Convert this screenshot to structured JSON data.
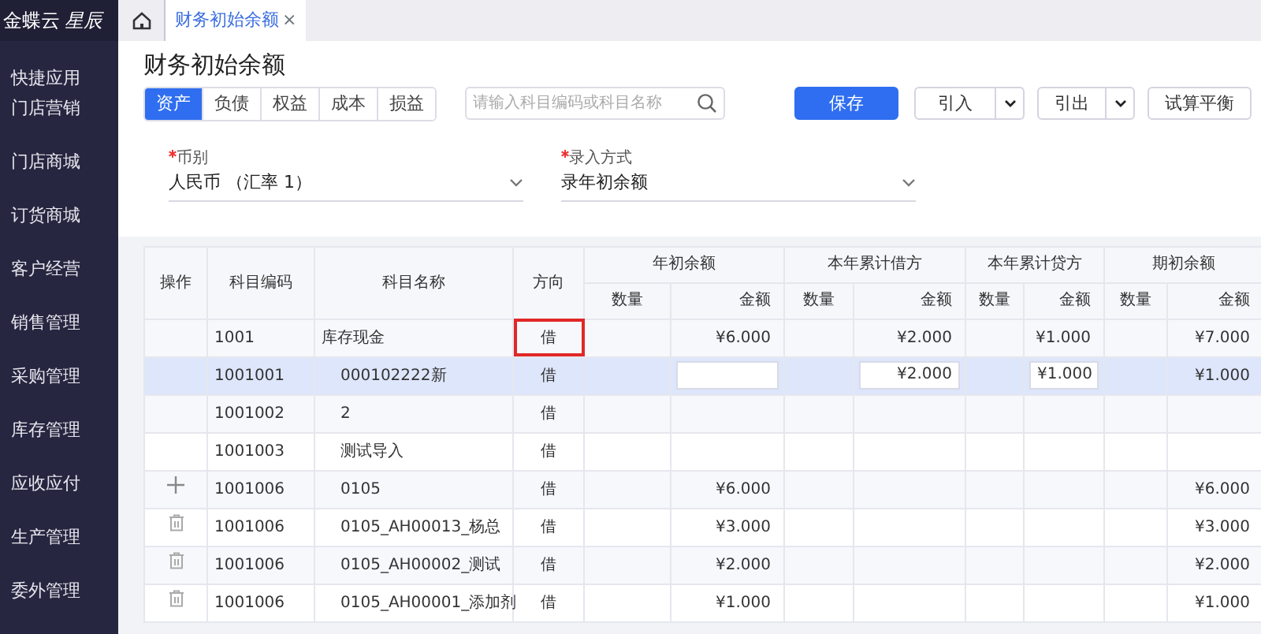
{
  "logo": {
    "brand": "金蝶云",
    "product": "星辰"
  },
  "sidebar": {
    "items": [
      {
        "label": "快捷应用"
      },
      {
        "label": "门店营销"
      },
      {
        "label": "门店商城"
      },
      {
        "label": "订货商城"
      },
      {
        "label": "客户经营"
      },
      {
        "label": "销售管理"
      },
      {
        "label": "采购管理"
      },
      {
        "label": "库存管理"
      },
      {
        "label": "应收应付"
      },
      {
        "label": "生产管理"
      },
      {
        "label": "委外管理"
      }
    ]
  },
  "page_tabs": [
    {
      "label": "财务初始余额",
      "close": "×",
      "selected": true
    }
  ],
  "title": "财务初始余额",
  "category_tabs": [
    {
      "label": "资产",
      "selected": true
    },
    {
      "label": "负债",
      "selected": false
    },
    {
      "label": "权益",
      "selected": false
    },
    {
      "label": "成本",
      "selected": false
    },
    {
      "label": "损益",
      "selected": false
    }
  ],
  "search": {
    "placeholder": "请输入科目编码或科目名称"
  },
  "actions": [
    {
      "label": "保存",
      "kind": "primary"
    },
    {
      "label": "引入",
      "kind": "split"
    },
    {
      "label": "引出",
      "kind": "split"
    },
    {
      "label": "试算平衡",
      "kind": "plain"
    }
  ],
  "fields": [
    {
      "label": "币别",
      "required": true,
      "value": "人民币 （汇率 1）"
    },
    {
      "label": "录入方式",
      "required": true,
      "value": "录年初余额"
    }
  ],
  "table": {
    "columns": [
      "操作",
      "科目编码",
      "科目名称",
      "方向"
    ],
    "groups": [
      {
        "label": "年初余额",
        "sub": [
          "数量",
          "金额"
        ]
      },
      {
        "label": "本年累计借方",
        "sub": [
          "数量",
          "金额"
        ]
      },
      {
        "label": "本年累计贷方",
        "sub": [
          "数量",
          "金额"
        ]
      },
      {
        "label": "期初余额",
        "sub": [
          "数量",
          "金额"
        ]
      }
    ],
    "rows": [
      {
        "code": "1001",
        "name": "库存现金",
        "direction": "借",
        "direction_flagged": true,
        "selected": false,
        "cells": [
          {},
          {
            "text": "¥6.000"
          },
          {},
          {
            "text": "¥2.000"
          },
          {},
          {
            "text": "¥1.000"
          },
          {},
          {
            "text": "¥7.000"
          }
        ],
        "children": [
          {
            "code": "1001001",
            "name": "000102222新",
            "direction": "借",
            "selected": true,
            "cells": [
              {},
              {
                "input": true
              },
              {},
              {
                "input": true,
                "text": "¥2.000"
              },
              {},
              {
                "input": true,
                "text": "¥1.000"
              },
              {},
              {
                "text": "¥1.000"
              }
            ]
          },
          {
            "code": "1001002",
            "name": "2",
            "direction": "借",
            "selected": false,
            "cells": [
              {},
              {},
              {},
              {},
              {},
              {},
              {},
              {}
            ]
          },
          {
            "code": "1001003",
            "name": "测试导入",
            "direction": "借",
            "selected": false,
            "cells": [
              {},
              {},
              {},
              {},
              {},
              {},
              {},
              {}
            ]
          },
          {
            "kind": "add",
            "code": "1001006",
            "name": "0105",
            "direction": "借",
            "selected": false,
            "cells": [
              {},
              {
                "text": "¥6.000"
              },
              {},
              {},
              {},
              {},
              {},
              {
                "text": "¥6.000"
              }
            ]
          },
          {
            "kind": "delete",
            "code": "1001006",
            "name": "0105_AH00013_杨总",
            "direction": "借",
            "selected": false,
            "cells": [
              {},
              {
                "text": "¥3.000"
              },
              {},
              {},
              {},
              {},
              {},
              {
                "text": "¥3.000"
              }
            ]
          },
          {
            "kind": "delete",
            "code": "1001006",
            "name": "0105_AH00002_测试",
            "direction": "借",
            "selected": false,
            "cells": [
              {},
              {
                "text": "¥2.000"
              },
              {},
              {},
              {},
              {},
              {},
              {
                "text": "¥2.000"
              }
            ]
          },
          {
            "kind": "delete",
            "code": "1001006",
            "name": "0105_AH00001_添加剂",
            "direction": "借",
            "selected": false,
            "cells": [
              {},
              {
                "text": "¥1.000"
              },
              {},
              {},
              {},
              {},
              {},
              {
                "text": "¥1.000"
              }
            ]
          }
        ]
      }
    ]
  }
}
